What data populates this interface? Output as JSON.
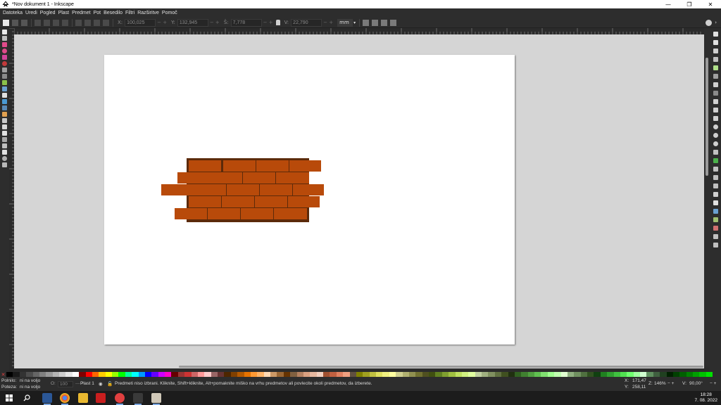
{
  "window": {
    "title": "*Nov dokument 1 - Inkscape",
    "controls": [
      "—",
      "❐",
      "✕"
    ]
  },
  "menu": [
    "Datoteka",
    "Uredi",
    "Pogled",
    "Plast",
    "Predmet",
    "Pot",
    "Besedilo",
    "Filtri",
    "Razširitve",
    "Pomoč"
  ],
  "toolbar": {
    "x_label": "X:",
    "x_value": "100,025",
    "y_label": "Y:",
    "y_value": "132,945",
    "w_label": "Š:",
    "w_value": "7,778",
    "h_label": "V:",
    "h_value": "22,790",
    "unit": "mm"
  },
  "statusbar": {
    "fill_label": "Polnilo:",
    "fill_value": "ni na voljo",
    "stroke_label": "Poteza:",
    "stroke_value": "ni na voljo",
    "opacity_label": "O:",
    "opacity_value": "100",
    "layer": "Plast 1",
    "message": "Predmeti niso izbrani. Kliknite, Shift+kliknite, Alt+pomaknite miško na vrhu predmetov ali povlecite okoli predmetov, da izberete.",
    "x_label": "X:",
    "x_value": "171,47",
    "y_label": "Y:",
    "y_value": "258,11",
    "zoom_label": "Z:",
    "zoom_value": "146%",
    "rotate_label": "V:",
    "rotate_value": "90,00°"
  },
  "taskbar": {
    "time": "18:28",
    "date": "7. 08. 2022"
  },
  "colors": {
    "brick": "#b84a0a",
    "mortar": "#5c2a0a",
    "canvas": "#d5d5d5",
    "page": "#ffffff",
    "ui_dark": "#2d2d2d"
  }
}
